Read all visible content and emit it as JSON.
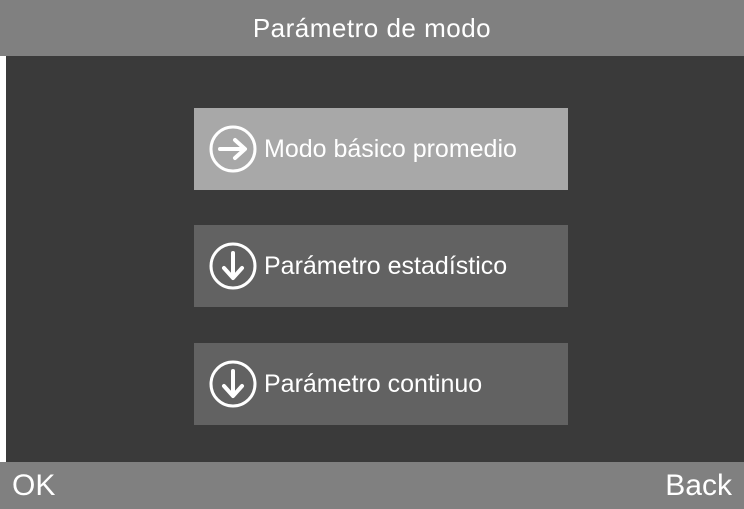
{
  "header": {
    "title": "Parámetro de modo"
  },
  "menu": {
    "items": [
      {
        "label": "Modo básico promedio",
        "icon": "arrow-right-circle-icon",
        "selected": true
      },
      {
        "label": "Parámetro estadístico",
        "icon": "arrow-down-circle-icon",
        "selected": false
      },
      {
        "label": "Parámetro continuo",
        "icon": "arrow-down-circle-icon",
        "selected": false
      }
    ]
  },
  "softkeys": {
    "ok_label": "OK",
    "back_label": "Back"
  },
  "colors": {
    "title_bar": "#808080",
    "background": "#3a3a3a",
    "button_selected": "#a8a8a8",
    "button_normal": "#626262",
    "text": "#ffffff"
  }
}
